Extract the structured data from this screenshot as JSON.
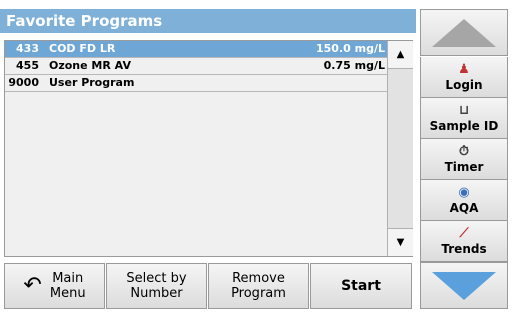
{
  "header": {
    "title": "Favorite Programs"
  },
  "programs": [
    {
      "number": "433",
      "name": "COD FD LR",
      "value": "150.0 mg/L",
      "selected": true
    },
    {
      "number": "455",
      "name": "Ozone MR AV",
      "value": "0.75 mg/L",
      "selected": false
    },
    {
      "number": "9000",
      "name": "User Program",
      "value": "",
      "selected": false
    }
  ],
  "scroll": {
    "up_icon": "triangle-up",
    "down_icon": "triangle-down"
  },
  "bottom_bar": {
    "main_menu": "Main\nMenu",
    "select_by_number": "Select by\nNumber",
    "remove_program": "Remove\nProgram",
    "start": "Start"
  },
  "side_panel": {
    "login": "Login",
    "sample_id": "Sample ID",
    "timer": "Timer",
    "aqa": "AQA",
    "trends": "Trends"
  },
  "colors": {
    "title_bg": "#7eb0d8",
    "selected_row": "#6ea7d6",
    "down_arrow": "#5aa0dc",
    "up_arrow": "#a6a6a6"
  }
}
